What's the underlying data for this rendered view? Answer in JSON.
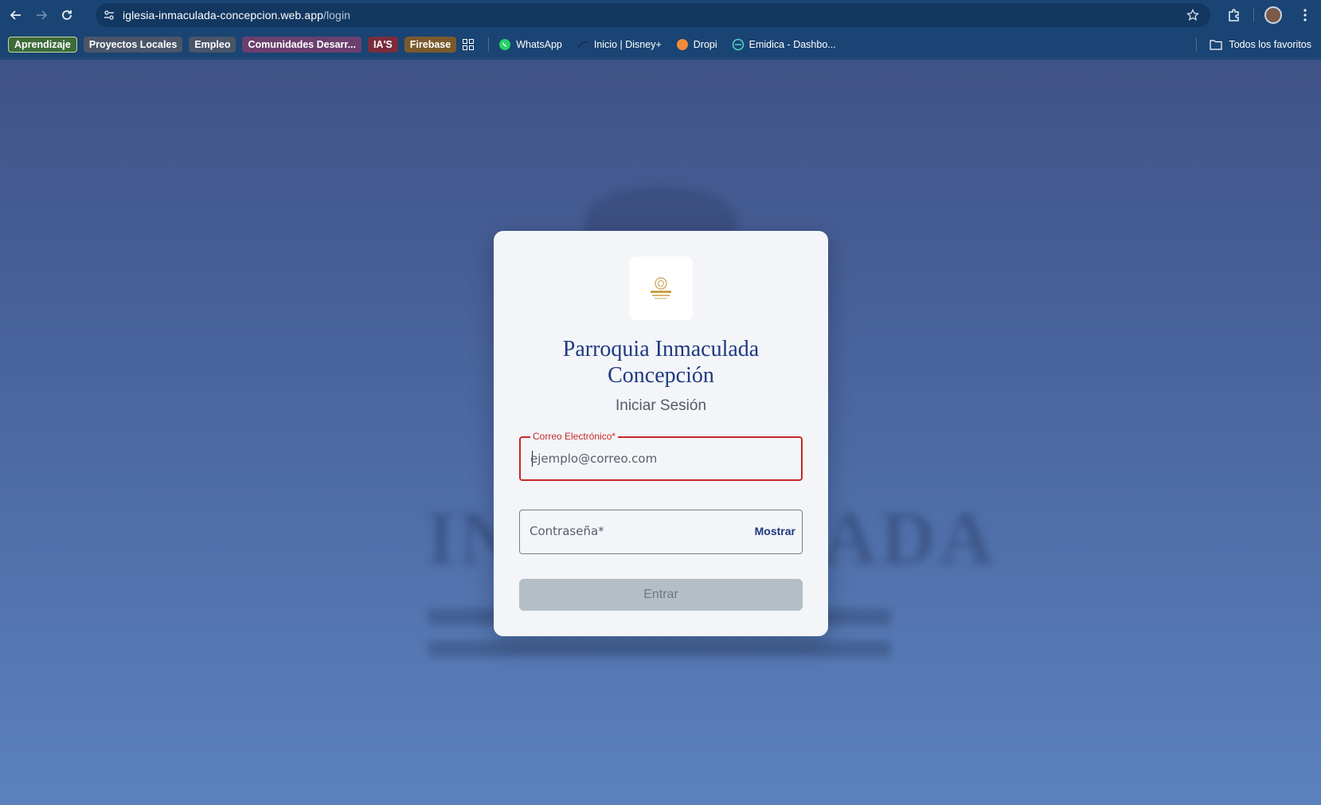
{
  "browser": {
    "url_host": "iglesia-inmaculada-concepcion.web.app",
    "url_path": "/login"
  },
  "bookmarks": {
    "chips": [
      {
        "label": "Aprendizaje",
        "color": "#3d6b3a"
      },
      {
        "label": "Proyectos Locales",
        "color": "#4a5568"
      },
      {
        "label": "Empleo",
        "color": "#4a5568"
      },
      {
        "label": "Comunidades Desarr...",
        "color": "#6b3f6e"
      },
      {
        "label": "IA'S",
        "color": "#7a2d3d"
      },
      {
        "label": "Firebase",
        "color": "#7a5a2d"
      }
    ],
    "links": [
      {
        "label": "WhatsApp",
        "icon": "whatsapp-icon"
      },
      {
        "label": "Inicio | Disney+",
        "icon": "disney-icon"
      },
      {
        "label": "Dropi",
        "icon": "dropi-icon"
      },
      {
        "label": "Emidica - Dashbo...",
        "icon": "emidica-icon"
      }
    ],
    "all_favorites": "Todos los favoritos"
  },
  "login": {
    "title_line1": "Parroquia Inmaculada",
    "title_line2": "Concepción",
    "subtitle": "Iniciar Sesión",
    "email_label": "Correo Electrónico*",
    "email_placeholder": "ejemplo@correo.com",
    "password_placeholder": "Contraseña*",
    "show_label": "Mostrar",
    "submit_label": "Entrar"
  },
  "colors": {
    "title": "#1f3a80",
    "error": "#c62828",
    "submit_disabled": "#b3bec6"
  }
}
